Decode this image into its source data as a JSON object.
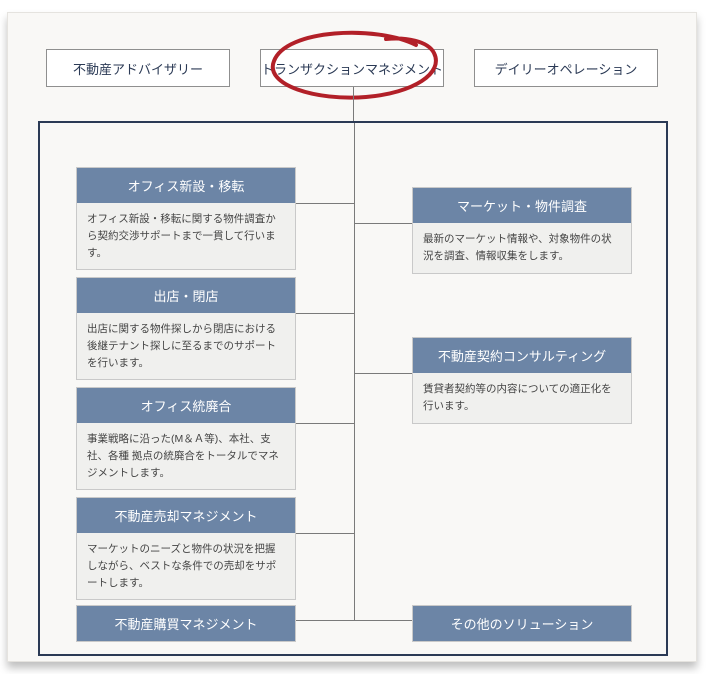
{
  "tabs": {
    "left": "不動産アドバイザリー",
    "center": "トランザクションマネジメント",
    "right": "デイリーオペレーション"
  },
  "left_cards": [
    {
      "title": "オフィス新設・移転",
      "desc": "オフィス新設・移転に関する物件調査から契約交渉サポートまで一貫して行います。"
    },
    {
      "title": "出店・閉店",
      "desc": "出店に関する物件探しから閉店における後継テナント探しに至るまでのサポートを行います。"
    },
    {
      "title": "オフィス統廃合",
      "desc": "事業戦略に沿った(M＆Ａ等)、本社、支社、各種 拠点の統廃合をトータルでマネジメントします。"
    },
    {
      "title": "不動産売却マネジメント",
      "desc": "マーケットのニーズと物件の状況を把握しながら、ベストな条件での売却をサポートします。"
    }
  ],
  "right_cards": [
    {
      "title": "マーケット・物件調査",
      "desc": "最新のマーケット情報や、対象物件の状況を調査、情報収集をします。"
    },
    {
      "title": "不動産契約コンサルティング",
      "desc": "賃貸者契約等の内容についての適正化を行います。"
    }
  ],
  "bottom_left": "不動産購買マネジメント",
  "bottom_right": "その他のソリューション"
}
